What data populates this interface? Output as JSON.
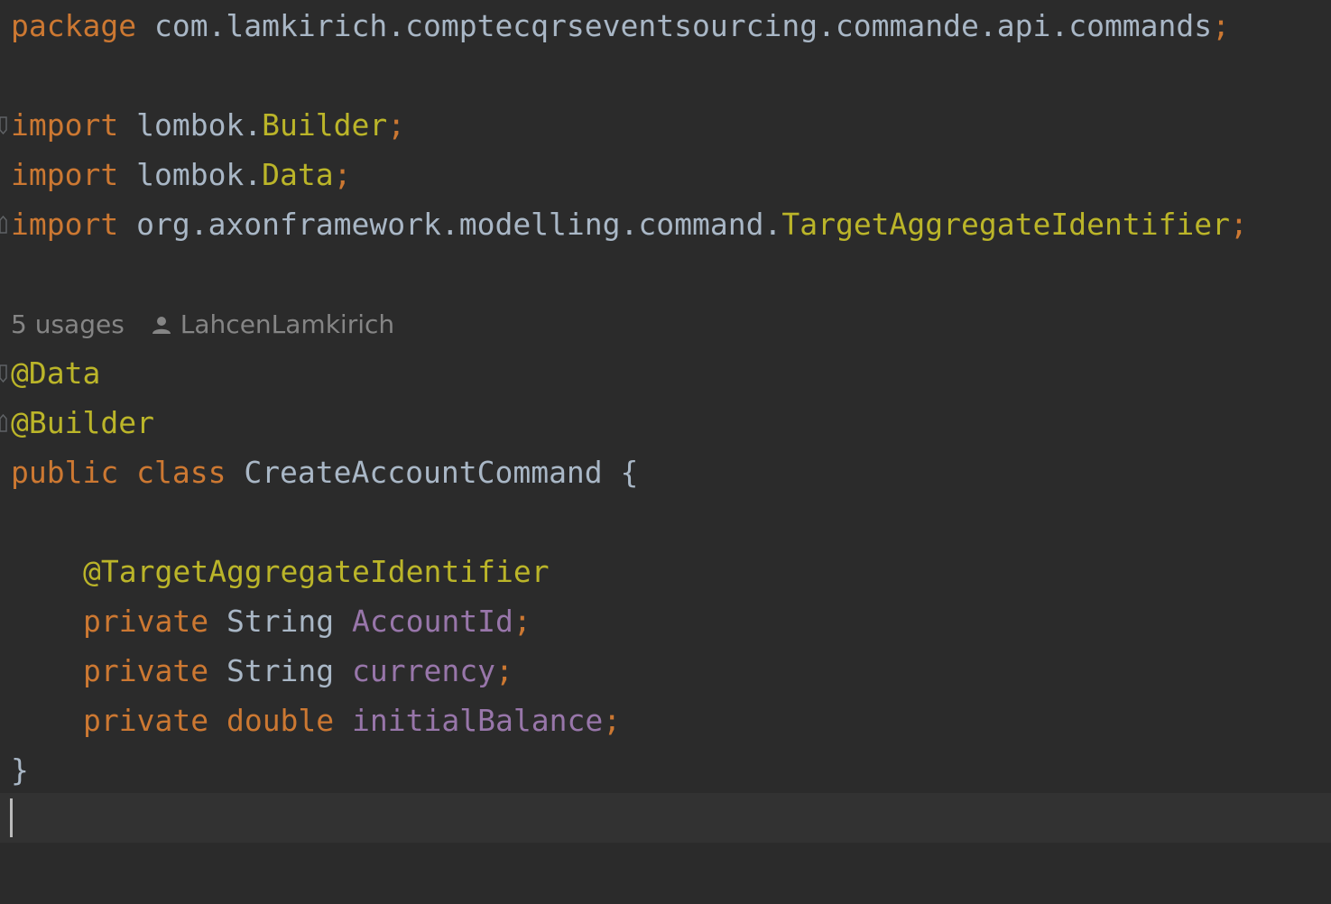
{
  "code": {
    "package_kw": "package",
    "package_name": "com.lamkirich.comptecqrseventsourcing.commande.api.commands",
    "semicolon": ";",
    "import_kw": "import",
    "imports": [
      {
        "prefix": "lombok.",
        "name": "Builder"
      },
      {
        "prefix": "lombok.",
        "name": "Data"
      },
      {
        "prefix": "org.axonframework.modelling.command.",
        "name": "TargetAggregateIdentifier"
      }
    ],
    "inlay": {
      "usages": "5 usages",
      "author": "LahcenLamkirich"
    },
    "class_annotations": [
      "@Data",
      "@Builder"
    ],
    "class_decl": {
      "public_kw": "public",
      "class_kw": "class",
      "class_name": "CreateAccountCommand",
      "open_brace": "{",
      "close_brace": "}"
    },
    "field_annotation": "@TargetAggregateIdentifier",
    "fields": [
      {
        "modifier": "private",
        "type": "String",
        "name": "AccountId"
      },
      {
        "modifier": "private",
        "type": "String",
        "name": "currency"
      },
      {
        "modifier": "private",
        "type": "double",
        "name": "initialBalance"
      }
    ]
  },
  "colors": {
    "background": "#2b2b2b",
    "keyword": "#cc7832",
    "annotation": "#bbb529",
    "field": "#9876aa",
    "plain": "#a9b7c6",
    "inlay_hint": "#858585",
    "current_line": "#323232"
  },
  "icons": {
    "author": "user-icon",
    "fold": "fold-marker-icon"
  }
}
